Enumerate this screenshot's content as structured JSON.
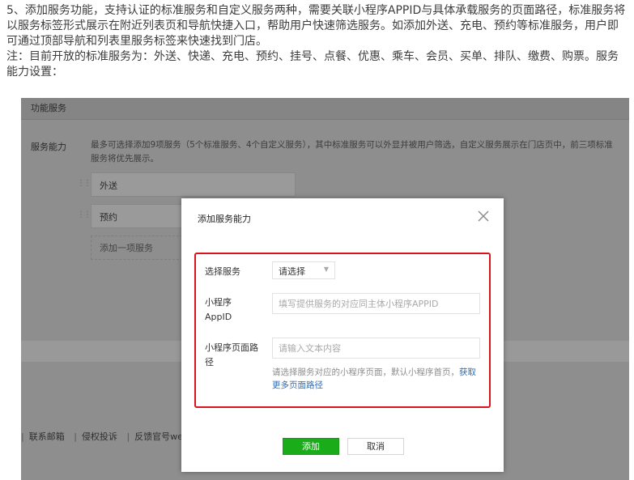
{
  "intro": {
    "line1": "5、添加服务功能，支持认证的标准服务和自定义服务两种，需要关联小程序APPID与具体承载服务的页面路径，标准服务将以服务标签形式展示在附近列表页和导航快捷入口，帮助用户快速筛选服务。如添加外送、充电、预约等标准服务，用户即可通过顶部导航和列表里服务标签来快速找到门店。",
    "line2": "注：目前开放的标准服务为：外送、快递、充电、预约、挂号、点餐、优惠、乘车、会员、买单、排队、缴费、购票。服务能力设置："
  },
  "background": {
    "section_title": "功能服务",
    "capability_label": "服务能力",
    "capability_desc": "最多可选择添加9项服务（5个标准服务、4个自定义服务），其中标准服务可以外显并被用户筛选，自定义服务展示在门店页中，前三项标准服务将优先展示。",
    "services": [
      "外送",
      "预约"
    ],
    "add_service": "添加一项服务",
    "footer_links": [
      "联系邮箱",
      "侵权投诉",
      "反馈官号we"
    ]
  },
  "dialog": {
    "title": "添加服务能力",
    "select_label": "选择服务",
    "select_value": "请选择",
    "appid_label_1": "小程序",
    "appid_label_2": "AppID",
    "appid_placeholder": "填写提供服务的对应同主体小程序APPID",
    "path_label_1": "小程序页面路",
    "path_label_2": "径",
    "path_placeholder": "请输入文本内容",
    "hint_text": "请选择服务对应的小程序页面，默认小程序首页，",
    "hint_link": "获取更多页面路径",
    "add_button": "添加",
    "cancel_button": "取消"
  },
  "colors": {
    "primary_green": "#1aad19",
    "highlight_red": "#d9141c",
    "link_blue": "#2a6ebc",
    "overlay_gray": "#8e8e8e"
  },
  "icons": {
    "close": "close-icon",
    "dropdown": "chevron-down-icon",
    "drag": "drag-handle-icon"
  }
}
